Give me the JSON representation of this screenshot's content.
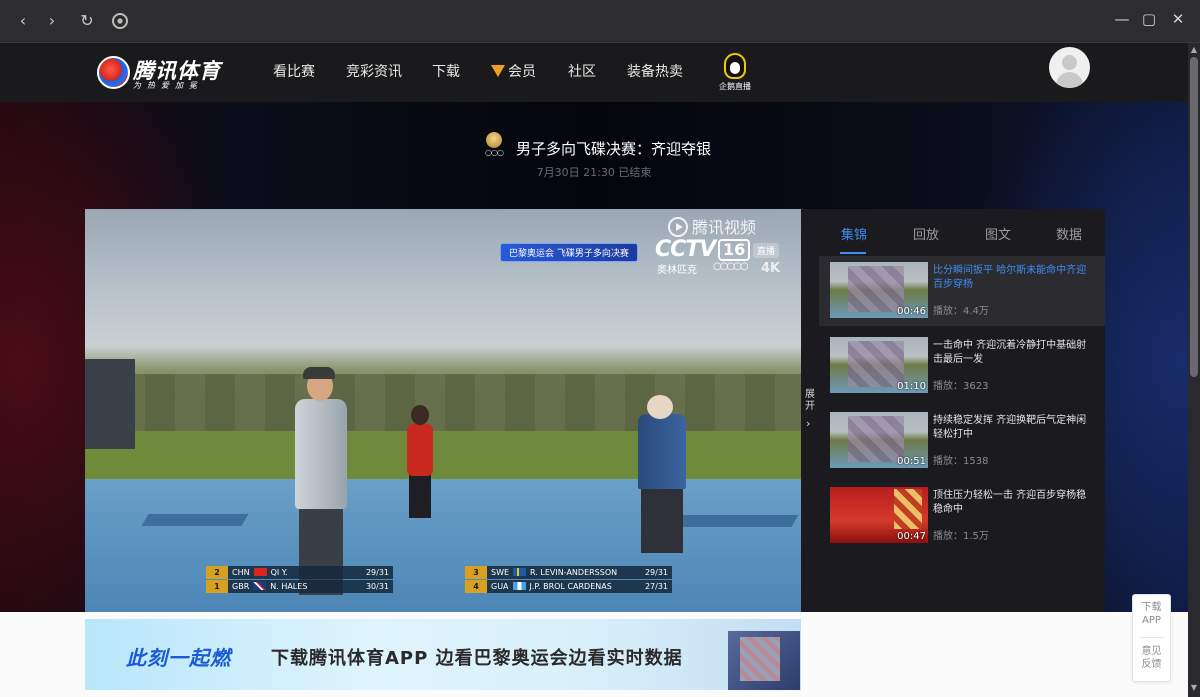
{
  "browser": {
    "back_glyph": "‹",
    "forward_glyph": "›",
    "reload_glyph": "↻",
    "minimize_glyph": "—",
    "maximize_glyph": "▢",
    "close_glyph": "✕"
  },
  "header": {
    "logo_text": "腾讯体育",
    "logo_sub": "为热爱加冕",
    "nav": [
      "看比赛",
      "竞彩资讯",
      "下载",
      "会员",
      "社区",
      "装备热卖"
    ],
    "live_label": "企鹅直播"
  },
  "event": {
    "title": "男子多向飞碟决赛：齐迎夺银",
    "time": "7月30日 21:30 已结束"
  },
  "player": {
    "watermark": "腾讯视频",
    "banner": "巴黎奥运会 飞碟男子多向决赛",
    "channel": "CCTV",
    "channel_num": "16",
    "channel_tag": "直播",
    "channel_sub": "奥林匹克",
    "rings": "○○○○○",
    "quality": "4K",
    "scoreboard_left": [
      {
        "rank": "2",
        "country": "CHN",
        "name": "QI Y.",
        "score": "29/31"
      },
      {
        "rank": "1",
        "country": "GBR",
        "name": "N. HALES",
        "score": "30/31"
      }
    ],
    "scoreboard_right": [
      {
        "rank": "3",
        "country": "SWE",
        "name": "R. LEVIN-ANDERSSON",
        "score": "29/31"
      },
      {
        "rank": "4",
        "country": "GUA",
        "name": "J.P. BROL CARDENAS",
        "score": "27/31"
      }
    ],
    "expand_label": "展开",
    "expand_glyph": "›"
  },
  "panel": {
    "tabs": [
      "集锦",
      "回放",
      "图文",
      "数据"
    ],
    "active_tab": "集锦",
    "clips": [
      {
        "title": "比分瞬间扳平 哈尔斯未能命中齐迎百步穿杨",
        "duration": "00:46",
        "plays": "播放：4.4万",
        "active": true
      },
      {
        "title": "一击命中 齐迎沉着冷静打中基础射击最后一发",
        "duration": "01:10",
        "plays": "播放：3623",
        "active": false
      },
      {
        "title": "持续稳定发挥 齐迎换靶后气定神闲轻松打中",
        "duration": "00:51",
        "plays": "播放：1538",
        "active": false
      },
      {
        "title": "顶住压力轻松一击 齐迎百步穿杨稳稳命中",
        "duration": "00:47",
        "plays": "播放：1.5万",
        "active": false
      }
    ]
  },
  "ad": {
    "slogan": "此刻一起燃",
    "text": "下载腾讯体育APP  边看巴黎奥运会边看实时数据"
  },
  "float": {
    "download_line1": "下载",
    "download_line2": "APP",
    "feedback_line1": "意见",
    "feedback_line2": "反馈"
  },
  "scroll": {
    "up_glyph": "▲",
    "down_glyph": "▼"
  },
  "colors": {
    "accent": "#3f8cf2",
    "header_bg": "#1a1a1c",
    "panel_bg": "#1b1b1f"
  }
}
